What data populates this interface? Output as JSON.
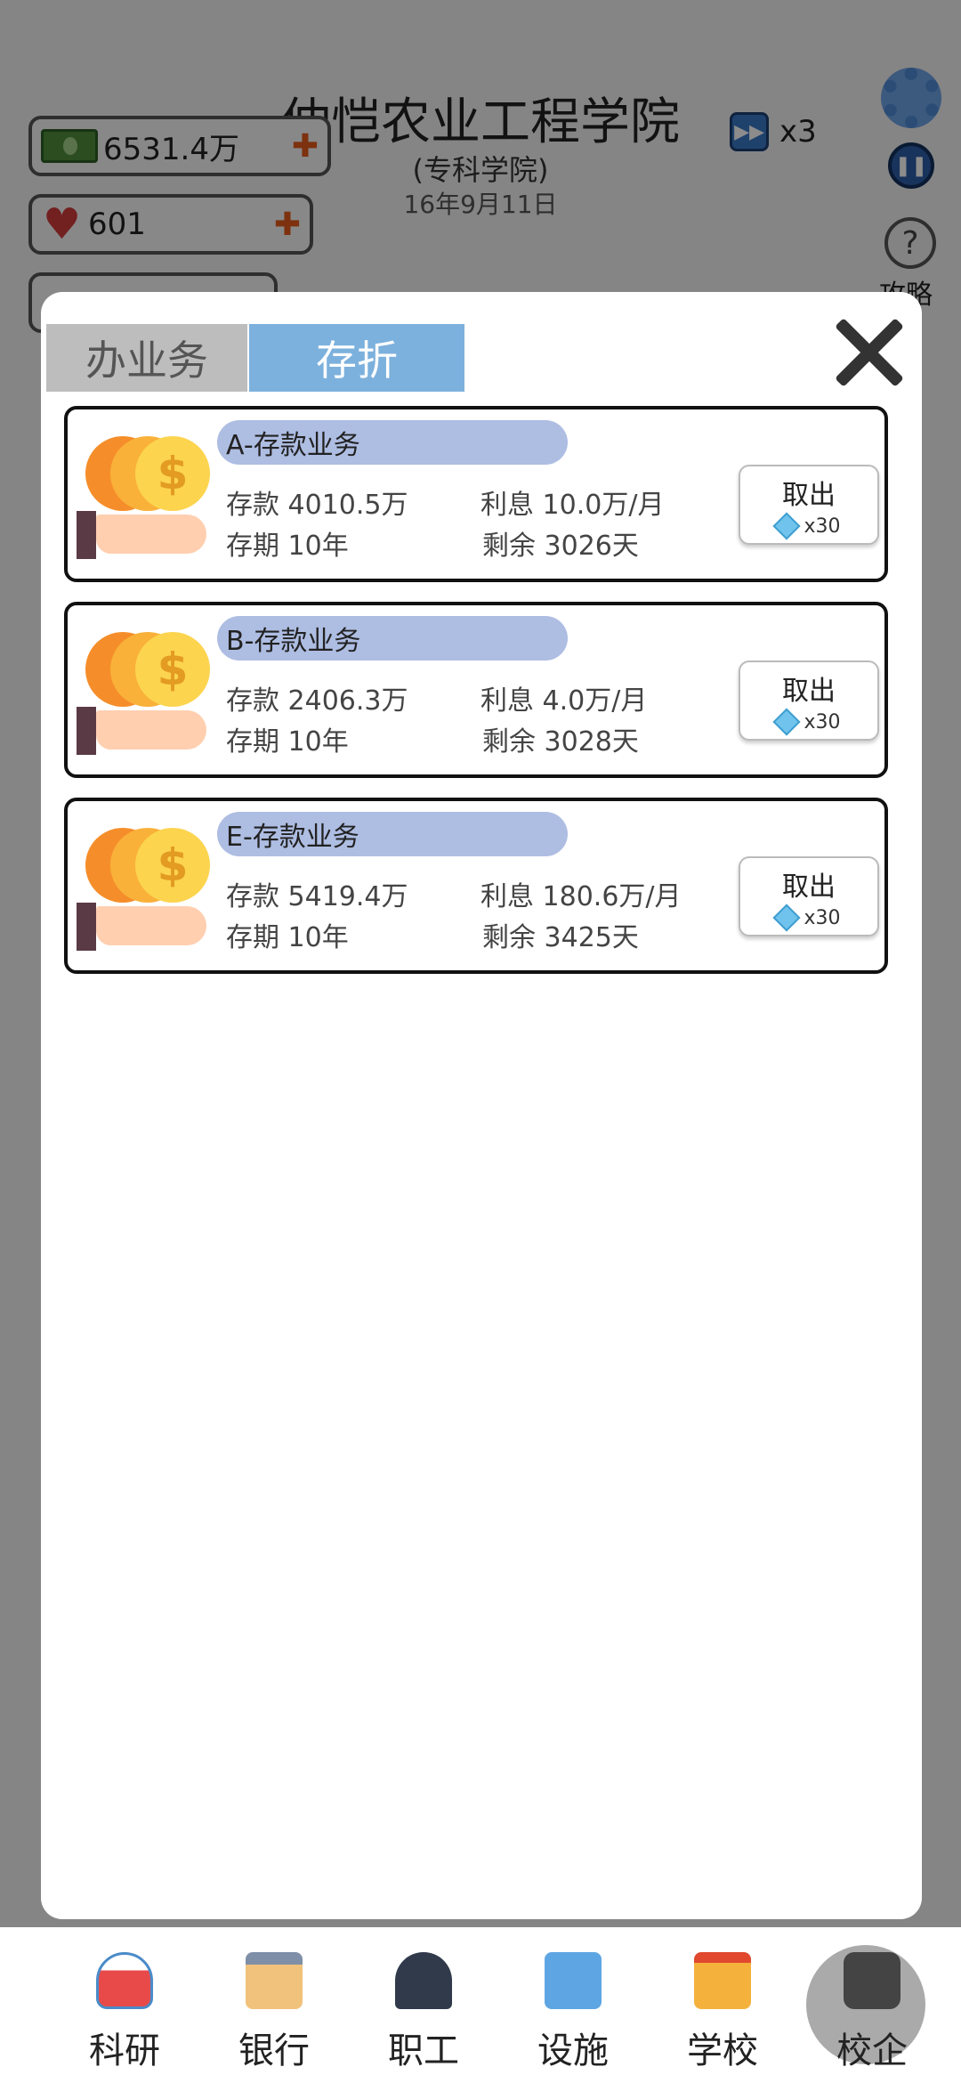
{
  "header": {
    "school_name": "仲恺农业工程学院",
    "school_type": "(专科学院)",
    "date": "16年9月11日",
    "money": "6531.4万",
    "hearts": "601",
    "speed": "x3",
    "help_label": "攻略"
  },
  "icons": {
    "money": "cash-icon",
    "heart": "heart-icon",
    "settings": "gear-icon",
    "pause": "pause-icon",
    "help": "question-icon",
    "diamond": "diamond-icon"
  },
  "modal": {
    "tabs": [
      {
        "label": "办业务",
        "active": false
      },
      {
        "label": "存折",
        "active": true
      }
    ],
    "deposits": [
      {
        "title": "A-存款业务",
        "amount": "存款 4010.5万",
        "term": "存期 10年",
        "interest": "利息 10.0万/月",
        "remaining": "剩余 3026天",
        "action": "取出",
        "cost": "x30"
      },
      {
        "title": "B-存款业务",
        "amount": "存款 2406.3万",
        "term": "存期 10年",
        "interest": "利息 4.0万/月",
        "remaining": "剩余 3028天",
        "action": "取出",
        "cost": "x30"
      },
      {
        "title": "E-存款业务",
        "amount": "存款 5419.4万",
        "term": "存期 10年",
        "interest": "利息 180.6万/月",
        "remaining": "剩余 3425天",
        "action": "取出",
        "cost": "x30"
      }
    ]
  },
  "nav": [
    {
      "label": "科研",
      "icon": "flask-icon"
    },
    {
      "label": "银行",
      "icon": "bank-icon"
    },
    {
      "label": "职工",
      "icon": "graduation-cap-icon"
    },
    {
      "label": "设施",
      "icon": "building-icon"
    },
    {
      "label": "学校",
      "icon": "school-icon"
    },
    {
      "label": "校企",
      "icon": "lock-icon",
      "locked": true
    }
  ],
  "colors": {
    "tab_active": "#7db1dd",
    "tab_inactive": "#bdbdbd",
    "card_title_bg": "#aebde2",
    "coin_orange": "#f58e2a"
  }
}
